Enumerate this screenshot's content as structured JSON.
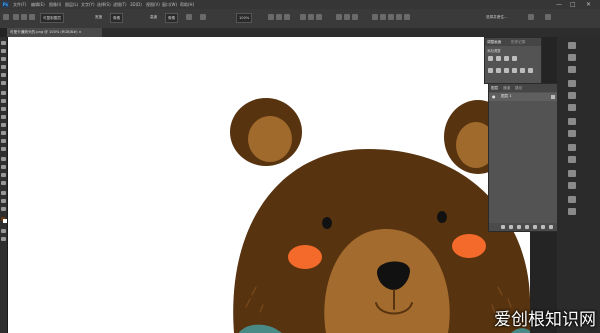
{
  "app": {
    "logo": "Ps",
    "menus": [
      "文件(F)",
      "编辑(E)",
      "图像(I)",
      "图层(L)",
      "文字(Y)",
      "选择(S)",
      "滤镜(T)",
      "3D(D)",
      "视图(V)",
      "窗口(W)",
      "帮助(H)"
    ],
    "window_controls": [
      "—",
      "□",
      "✕"
    ]
  },
  "options_bar": {
    "items": [
      "可复制图层",
      "宽度",
      "像素",
      "高度",
      "像素"
    ],
    "opacity_label": "100%",
    "right_label": "选择并遮住..."
  },
  "document": {
    "tab_title": "可爱卡通熊头的.png @ 100% (RGB/8#) ×"
  },
  "panels": {
    "top": {
      "tabs": [
        "调整画面",
        "历史记录"
      ],
      "row_label": "添加调整"
    },
    "layers": {
      "tabs": [
        "图层",
        "通道",
        "路径"
      ],
      "layer_name": "图层 1"
    }
  },
  "watermark": {
    "text": "爱创根知识网"
  },
  "colors": {
    "bear_dark": "#57330f",
    "bear_ear_inner": "#a06a2c",
    "muzzle": "#a46b2e",
    "cheek": "#f46a2a",
    "scarf": "#4a8a86"
  },
  "icons": [
    "ps-logo-icon",
    "move-tool-icon",
    "marquee-tool-icon",
    "lasso-tool-icon",
    "crop-tool-icon",
    "brush-tool-icon",
    "eraser-tool-icon",
    "text-tool-icon",
    "hand-tool-icon",
    "zoom-tool-icon",
    "eye-icon",
    "trash-icon"
  ]
}
